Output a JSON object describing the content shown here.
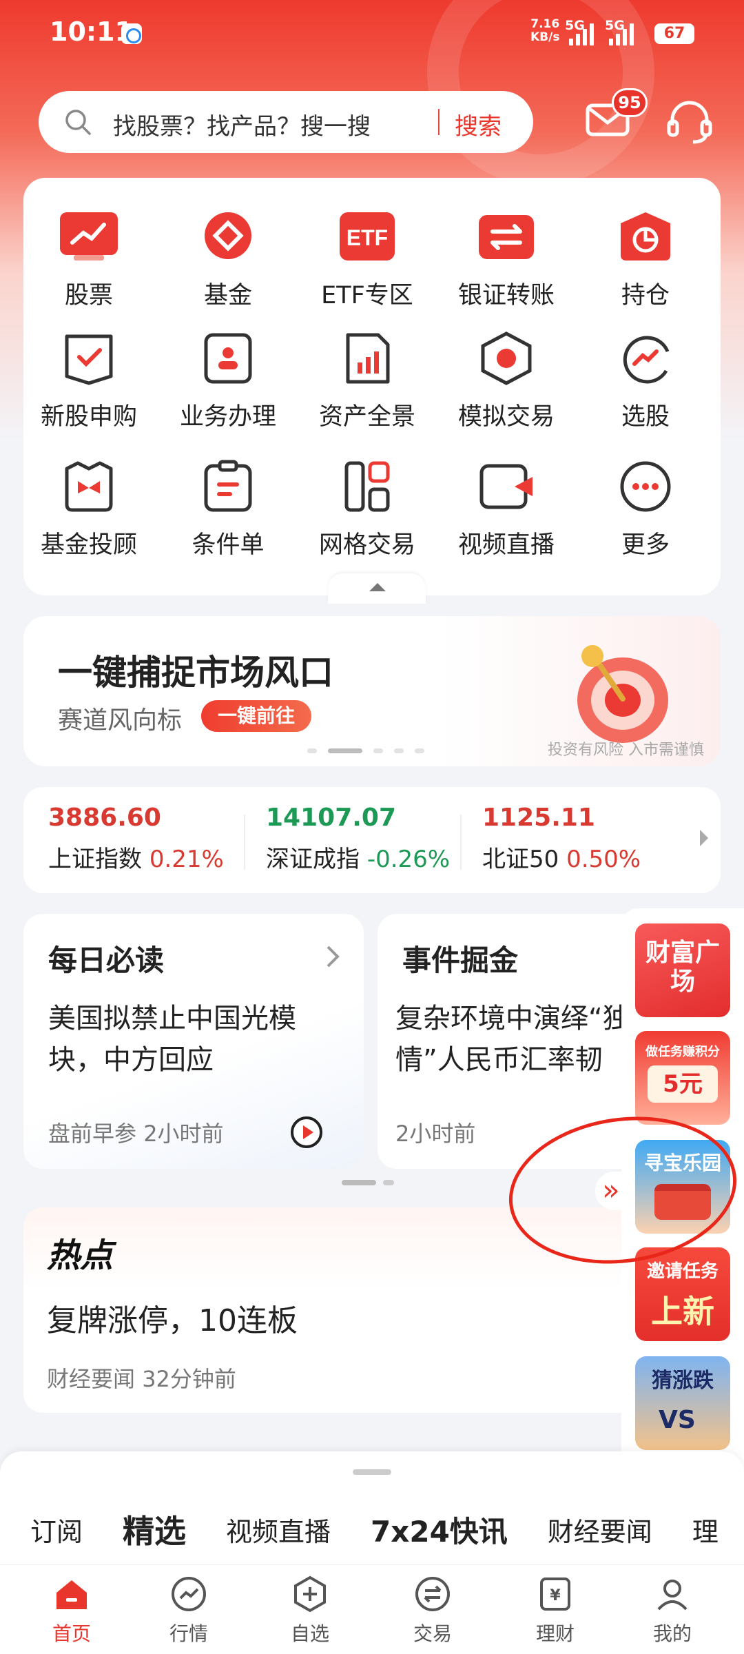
{
  "status": {
    "time": "10:11",
    "net_speed_value": "7.16",
    "net_speed_unit": "KB/s",
    "net1": "5G",
    "net2": "5G",
    "battery": "67"
  },
  "search": {
    "placeholder": "找股票？找产品？搜一搜",
    "button": "搜索"
  },
  "mail_badge": "95",
  "grid": [
    {
      "label": "股票",
      "icon": "stock-icon"
    },
    {
      "label": "基金",
      "icon": "fund-icon"
    },
    {
      "label": "ETF专区",
      "icon": "etf-icon"
    },
    {
      "label": "银证转账",
      "icon": "transfer-icon"
    },
    {
      "label": "持仓",
      "icon": "holdings-icon"
    },
    {
      "label": "新股申购",
      "icon": "ipo-icon"
    },
    {
      "label": "业务办理",
      "icon": "business-icon"
    },
    {
      "label": "资产全景",
      "icon": "assets-icon"
    },
    {
      "label": "模拟交易",
      "icon": "simulated-trade-icon"
    },
    {
      "label": "选股",
      "icon": "stock-picker-icon"
    },
    {
      "label": "基金投顾",
      "icon": "fund-advisor-icon"
    },
    {
      "label": "条件单",
      "icon": "conditional-order-icon"
    },
    {
      "label": "网格交易",
      "icon": "grid-trading-icon"
    },
    {
      "label": "视频直播",
      "icon": "video-live-icon"
    },
    {
      "label": "更多",
      "icon": "more-icon"
    }
  ],
  "banner": {
    "title": "一键捕捉市场风口",
    "subtitle": "赛道风向标",
    "button": "一键前往",
    "disclaimer": "投资有风险 入市需谨慎",
    "dots": 5,
    "active_dot": 1
  },
  "indices": [
    {
      "value": "3886.60",
      "name": "上证指数",
      "change": "0.21%",
      "color": "#d83a32"
    },
    {
      "value": "14107.07",
      "name": "深证成指",
      "change": "-0.26%",
      "color": "#1c9a55"
    },
    {
      "value": "1125.11",
      "name": "北证50",
      "change": "0.50%",
      "color": "#d83a32"
    }
  ],
  "articles": [
    {
      "title": "每日必读",
      "body": "美国拟禁止中国光模块，中方回应",
      "source": "盘前早参",
      "time": "2小时前"
    },
    {
      "title": "事件掘金",
      "body": "复杂环境中演绎“独立行情”人民币汇率韧",
      "time": "2小时前"
    }
  ],
  "hot": {
    "title": "热点",
    "body": "复牌涨停，10连板",
    "source": "财经要闻",
    "time": "32分钟前"
  },
  "float_items": [
    {
      "text": "财富广场"
    },
    {
      "text": "做任务赚积分",
      "price": "5元"
    },
    {
      "text": "寻宝乐园"
    },
    {
      "text": "邀请任务",
      "big": "上新"
    },
    {
      "text": "猜涨跌",
      "vs": "VS"
    }
  ],
  "feed_tabs": [
    {
      "label": "订阅"
    },
    {
      "label": "精选"
    },
    {
      "label": "视频直播"
    },
    {
      "label": "7x24快讯"
    },
    {
      "label": "财经要闻"
    },
    {
      "label": "理"
    }
  ],
  "nav": [
    {
      "label": "首页",
      "icon": "home-icon"
    },
    {
      "label": "行情",
      "icon": "market-icon"
    },
    {
      "label": "自选",
      "icon": "watchlist-icon"
    },
    {
      "label": "交易",
      "icon": "trade-icon"
    },
    {
      "label": "理财",
      "icon": "wealth-icon"
    },
    {
      "label": "我的",
      "icon": "profile-icon"
    }
  ],
  "colors": {
    "brand_red": "#e8362c",
    "up": "#d83a32",
    "down": "#1c9a55"
  }
}
